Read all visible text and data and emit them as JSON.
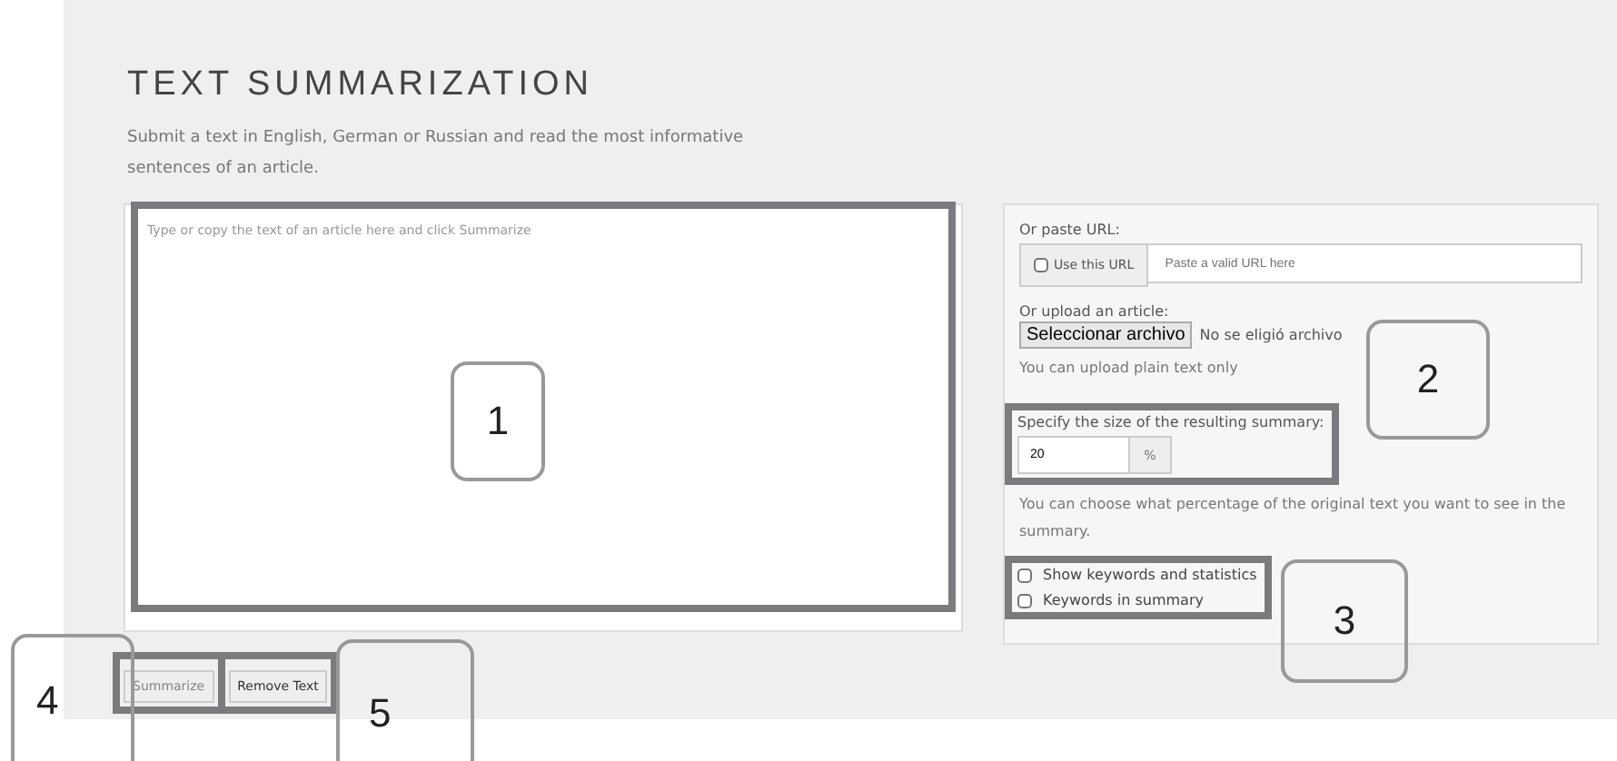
{
  "title": "TEXT SUMMARIZATION",
  "description": "Submit a text in English, German or Russian and read the most informative sentences of an article.",
  "article_field": {
    "placeholder": "Type or copy the text of an article here and click Summarize"
  },
  "url": {
    "label": "Or paste URL:",
    "toggle": {
      "label": "Use this URL",
      "checked": false
    },
    "placeholder": "Paste a valid URL here"
  },
  "upload": {
    "label": "Or upload an article:",
    "button": "Seleccionar archivo",
    "status": "No se eligió archivo",
    "hint": "You can upload plain text only"
  },
  "size": {
    "label": "Specify the size of the resulting summary:",
    "value": "20",
    "unit": "%",
    "hint": "You can choose what percentage of the original text you want to see in the summary."
  },
  "options": [
    {
      "label": "Show keywords and statistics",
      "checked": false
    },
    {
      "label": "Keywords in summary",
      "checked": false
    }
  ],
  "buttons": [
    {
      "label": "Summarize",
      "disabled": true
    },
    {
      "label": "Remove Text",
      "disabled": false
    }
  ],
  "callouts": [
    {
      "number": "1"
    },
    {
      "number": "2"
    },
    {
      "number": "3"
    },
    {
      "number": "4"
    },
    {
      "number": "5"
    }
  ]
}
